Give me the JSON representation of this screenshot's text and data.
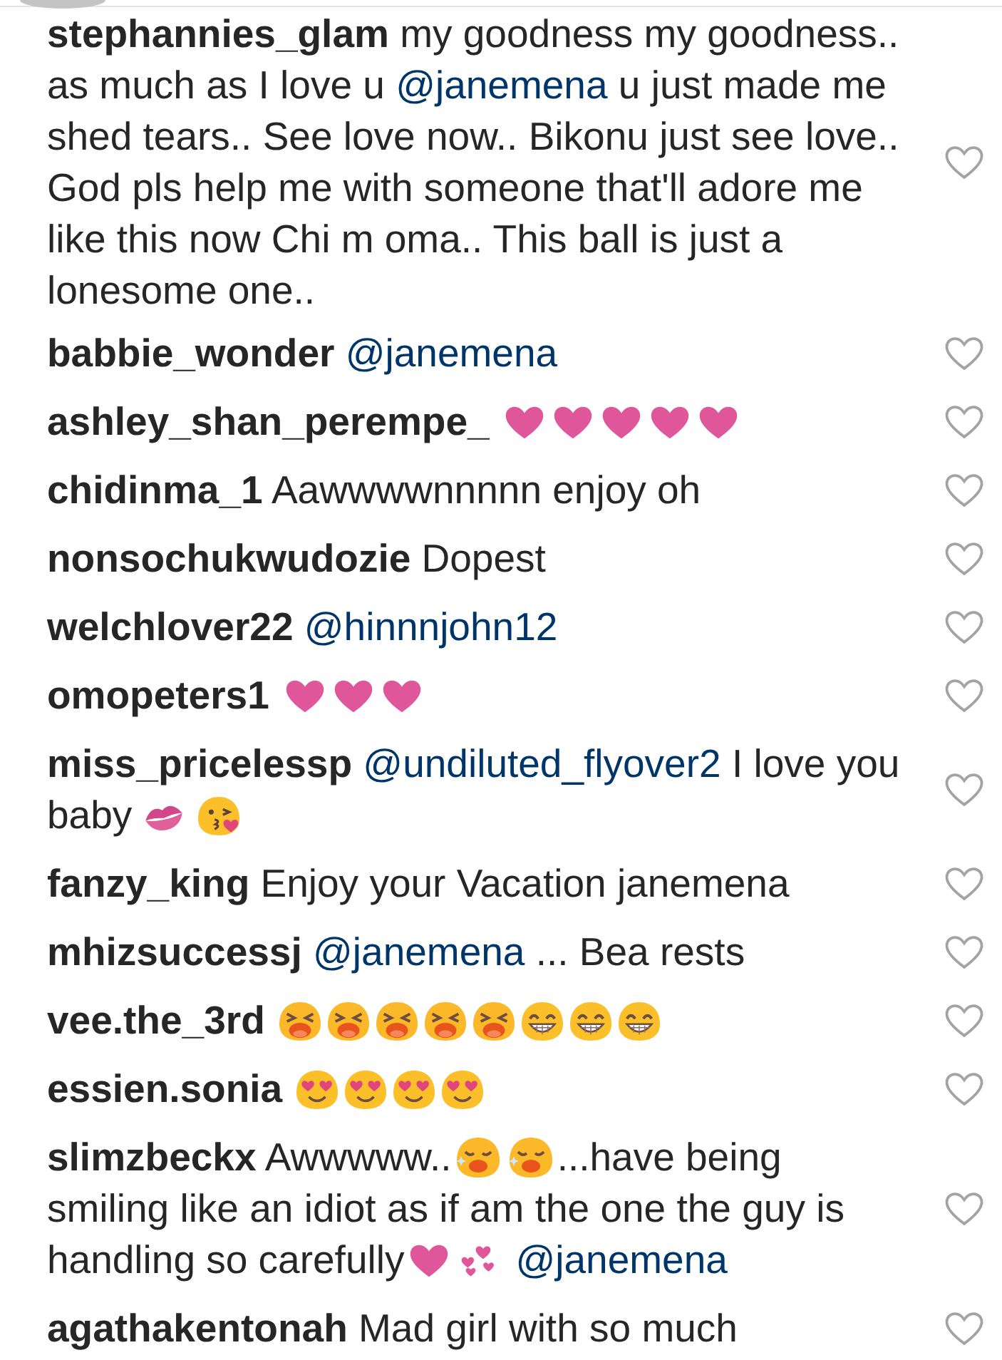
{
  "comments": [
    {
      "user": "stephannies_glam",
      "liked": false,
      "parts": [
        {
          "kind": "text",
          "text": "my goodness my goodness.. as much as I love u "
        },
        {
          "kind": "mention",
          "text": "@janemena"
        },
        {
          "kind": "text",
          "text": " u just made me shed tears.. See love now.. Bikonu just see love.. God pls help me with someone that'll adore me like this now Chi m oma.. This ball is just a lonesome one.."
        }
      ]
    },
    {
      "user": "babbie_wonder",
      "liked": false,
      "parts": [
        {
          "kind": "mention",
          "text": "@janemena"
        }
      ]
    },
    {
      "user": "ashley_shan_perempe_",
      "liked": false,
      "parts": [
        {
          "kind": "heart"
        },
        {
          "kind": "heart"
        },
        {
          "kind": "heart"
        },
        {
          "kind": "heart"
        },
        {
          "kind": "heart"
        }
      ]
    },
    {
      "user": "chidinma_1",
      "liked": false,
      "parts": [
        {
          "kind": "text",
          "text": "Aawwwwnnnnn enjoy oh"
        }
      ]
    },
    {
      "user": "nonsochukwudozie",
      "liked": false,
      "parts": [
        {
          "kind": "text",
          "text": "Dopest"
        }
      ]
    },
    {
      "user": "welchlover22",
      "liked": false,
      "parts": [
        {
          "kind": "mention",
          "text": "@hinnnjohn12"
        }
      ]
    },
    {
      "user": "omopeters1",
      "liked": false,
      "parts": [
        {
          "kind": "heart"
        },
        {
          "kind": "heart"
        },
        {
          "kind": "heart"
        }
      ]
    },
    {
      "user": "miss_pricelessp",
      "liked": false,
      "parts": [
        {
          "kind": "mention",
          "text": "@undiluted_flyover2"
        },
        {
          "kind": "text",
          "text": " I love you baby "
        },
        {
          "kind": "lips"
        },
        {
          "kind": "kissface"
        }
      ]
    },
    {
      "user": "fanzy_king",
      "liked": false,
      "parts": [
        {
          "kind": "text",
          "text": "Enjoy your Vacation janemena"
        }
      ]
    },
    {
      "user": "mhizsuccessj",
      "liked": false,
      "parts": [
        {
          "kind": "mention",
          "text": "@janemena"
        },
        {
          "kind": "text",
          "text": " ... Bea rests"
        }
      ]
    },
    {
      "user": "vee.the_3rd",
      "liked": false,
      "parts": [
        {
          "kind": "tiredface"
        },
        {
          "kind": "tiredface"
        },
        {
          "kind": "tiredface"
        },
        {
          "kind": "tiredface"
        },
        {
          "kind": "tiredface"
        },
        {
          "kind": "grinface"
        },
        {
          "kind": "grinface"
        },
        {
          "kind": "grinface"
        }
      ]
    },
    {
      "user": "essien.sonia",
      "liked": false,
      "parts": [
        {
          "kind": "hearteyes"
        },
        {
          "kind": "hearteyes"
        },
        {
          "kind": "hearteyes"
        },
        {
          "kind": "hearteyes"
        }
      ]
    },
    {
      "user": "slimzbeckx",
      "liked": false,
      "parts": [
        {
          "kind": "text",
          "text": "Awwwww.."
        },
        {
          "kind": "wearyface"
        },
        {
          "kind": "wearyface"
        },
        {
          "kind": "text",
          "text": "...have being smiling like an idiot as if am the one the guy is handling so carefully"
        },
        {
          "kind": "heart"
        },
        {
          "kind": "hearts"
        },
        {
          "kind": "mention",
          "text": "@janemena"
        }
      ]
    },
    {
      "user": "agathakentonah",
      "liked": false,
      "parts": [
        {
          "kind": "text",
          "text": "Mad girl with so much"
        }
      ]
    }
  ]
}
